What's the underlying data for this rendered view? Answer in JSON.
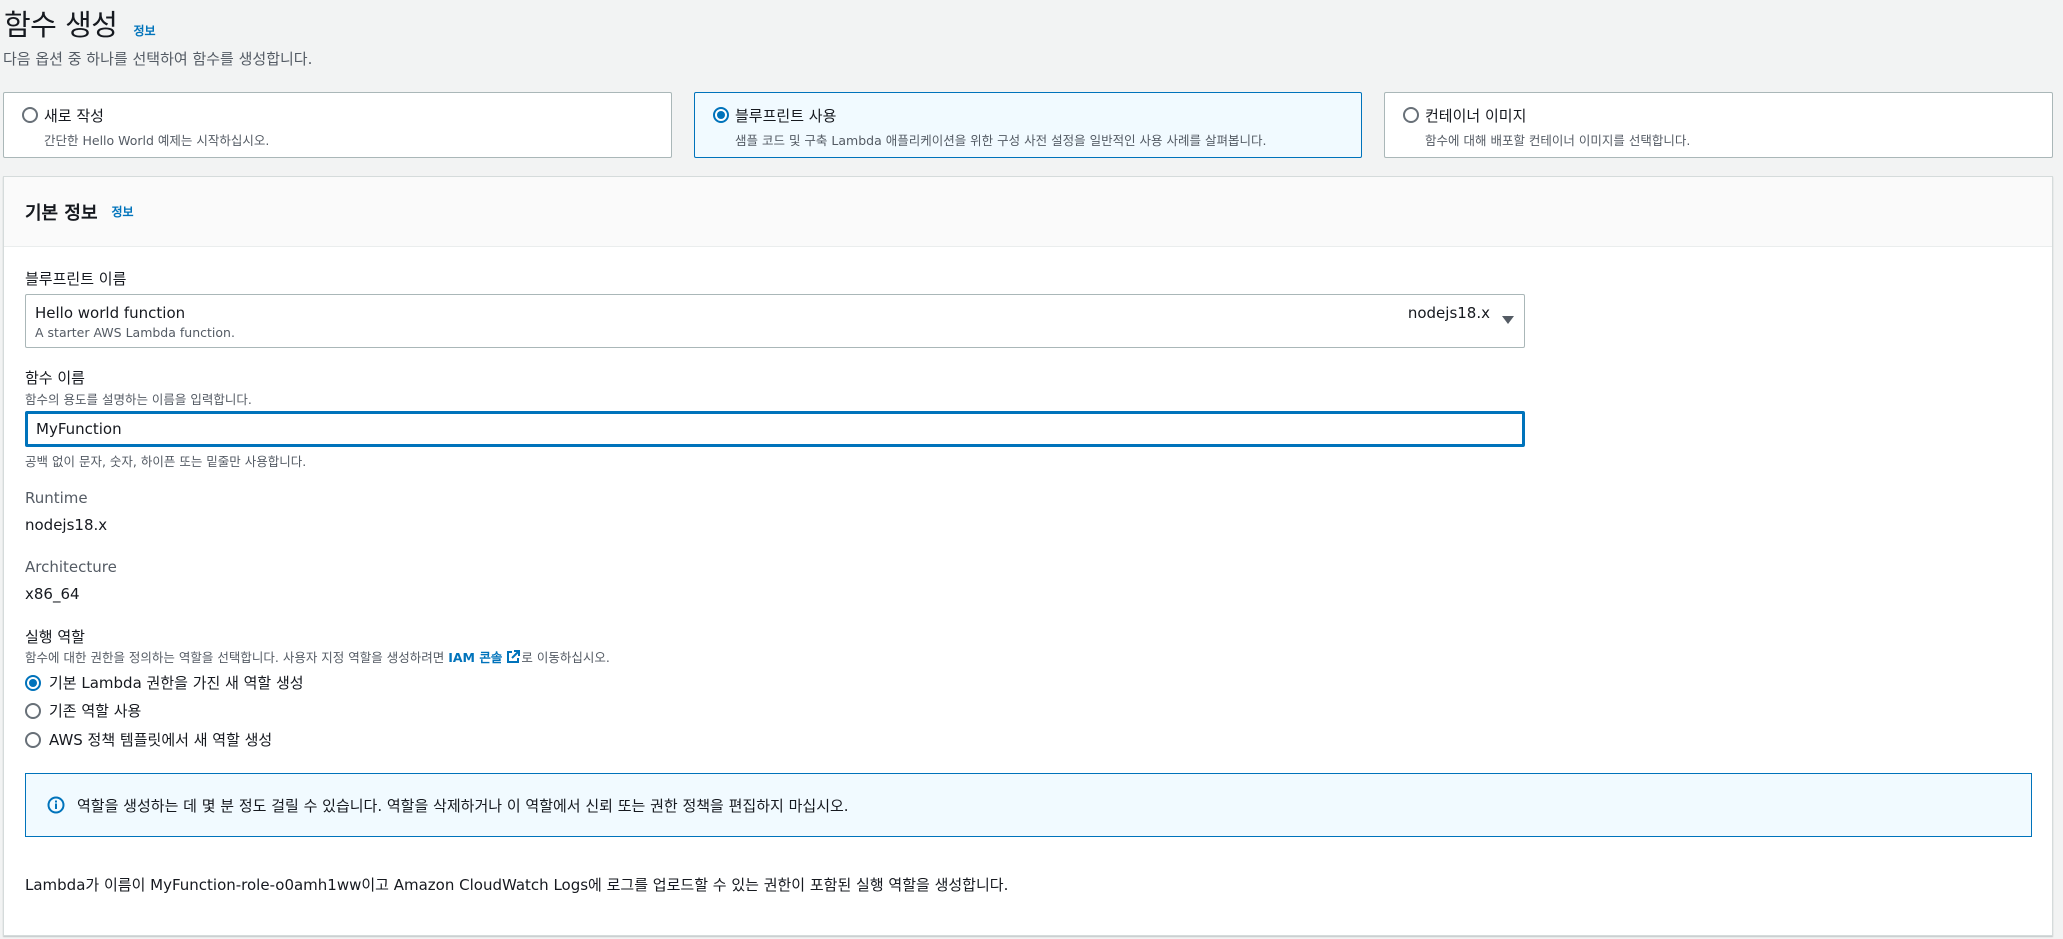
{
  "header": {
    "title": "함수 생성",
    "info": "정보",
    "subtitle": "다음 옵션 중 하나를 선택하여 함수를 생성합니다."
  },
  "options": [
    {
      "label": "새로 작성",
      "desc": "간단한 Hello World 예제는 시작하십시오.",
      "selected": false
    },
    {
      "label": "블루프린트 사용",
      "desc": "샘플 코드 및 구축 Lambda 애플리케이션을 위한 구성 사전 설정을 일반적인 사용 사례를 살펴봅니다.",
      "selected": true
    },
    {
      "label": "컨테이너 이미지",
      "desc": "함수에 대해 배포할 컨테이너 이미지를 선택합니다.",
      "selected": false
    }
  ],
  "basic": {
    "title": "기본 정보",
    "info": "정보",
    "blueprint_label": "블루프린트 이름",
    "blueprint_value": "Hello world function",
    "blueprint_desc": "A starter AWS Lambda function.",
    "blueprint_tag": "nodejs18.x",
    "function_label": "함수 이름",
    "function_hint": "함수의 용도를 설명하는 이름을 입력합니다.",
    "function_value": "MyFunction",
    "function_constraint": "공백 없이 문자, 숫자, 하이픈 또는 밑줄만 사용합니다.",
    "runtime_label": "Runtime",
    "runtime_value": "nodejs18.x",
    "arch_label": "Architecture",
    "arch_value": "x86_64",
    "role_label": "실행 역할",
    "role_hint_before": "함수에 대한 권한을 정의하는 역할을 선택합니다. 사용자 지정 역할을 생성하려면 ",
    "role_hint_link": "IAM 콘솔",
    "role_hint_after": "로 이동하십시오.",
    "role_options": [
      {
        "label": "기본 Lambda 권한을 가진 새 역할 생성",
        "checked": true
      },
      {
        "label": "기존 역할 사용",
        "checked": false
      },
      {
        "label": "AWS 정책 템플릿에서 새 역할 생성",
        "checked": false
      }
    ],
    "alert_text": "역할을 생성하는 데 몇 분 정도 걸릴 수 있습니다. 역할을 삭제하거나 이 역할에서 신뢰 또는 권한 정책을 편집하지 마십시오.",
    "footer_text": "Lambda가 이름이 MyFunction-role-o0amh1ww이고 Amazon CloudWatch Logs에 로그를 업로드할 수 있는 권한이 포함된 실행 역할을 생성합니다."
  },
  "colors": {
    "accent": "#0073bb",
    "selected_bg": "#f1faff"
  }
}
